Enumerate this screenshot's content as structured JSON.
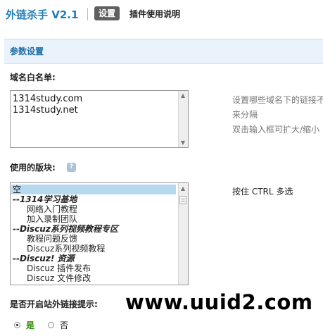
{
  "header": {
    "brand": "外链杀手 V2.1",
    "tabs": [
      {
        "label": "设置",
        "active": true
      },
      {
        "label": "插件使用说明",
        "active": false
      }
    ]
  },
  "section": {
    "title": "参数设置"
  },
  "whitelist": {
    "label": "域名白名单:",
    "value_lines": [
      "1314study.com",
      "1314study.net"
    ],
    "hints": [
      "设置哪些域名下的链接不",
      "来分隔",
      "双击输入框可扩大/缩小"
    ]
  },
  "boards": {
    "label": "使用的版块:",
    "hint": "按住 CTRL 多选",
    "options": [
      {
        "label": "空",
        "kind": "selected"
      },
      {
        "label": "--1314学习基地",
        "kind": "group"
      },
      {
        "label": "网络入门教程",
        "kind": "child"
      },
      {
        "label": "加入录制团队",
        "kind": "child"
      },
      {
        "label": "--Discuz系列视频教程专区",
        "kind": "group"
      },
      {
        "label": "教程问题反馈",
        "kind": "child"
      },
      {
        "label": "Discuz系列视频教程",
        "kind": "child"
      },
      {
        "label": "--Discuz! 资源",
        "kind": "group"
      },
      {
        "label": "Discuz 插件发布",
        "kind": "child"
      },
      {
        "label": "Discuz 文件修改",
        "kind": "child"
      }
    ]
  },
  "external_prompt": {
    "label": "是否开启站外链接提示:",
    "options": [
      {
        "label": "是",
        "checked": true
      },
      {
        "label": "否",
        "checked": false
      }
    ]
  },
  "watermark": "www.uuid2.com",
  "colors": {
    "brand": "#1f7fb8",
    "section_bg": "#eaf3fb",
    "selected_option": "#b7d9f0",
    "checked_label": "#2b8a00"
  }
}
